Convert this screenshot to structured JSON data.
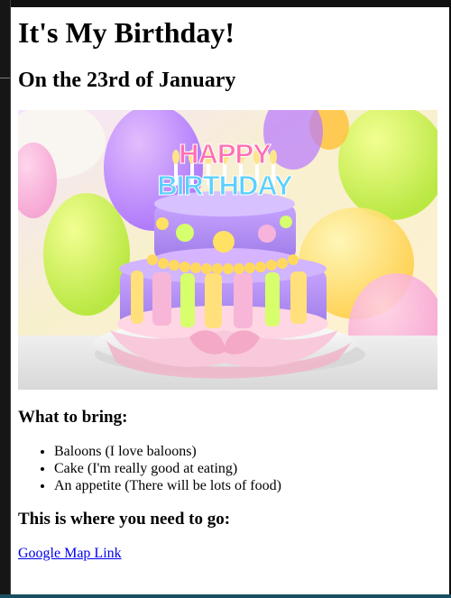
{
  "page": {
    "title": "It's My Birthday!",
    "subtitle": "On the 23rd of January"
  },
  "sections": {
    "bring_title": "What to bring:",
    "bring_items": [
      "Baloons (I love baloons)",
      "Cake (I'm really good at eating)",
      "An appetite (There will be lots of food)"
    ],
    "location_title": "This is where you need to go:",
    "map_link": "Google Map Link"
  },
  "image": {
    "cake_text": "HAPPY BIRTHDAY"
  },
  "colors": {
    "link": "#0000ee",
    "frame": "#1f1f1f"
  }
}
